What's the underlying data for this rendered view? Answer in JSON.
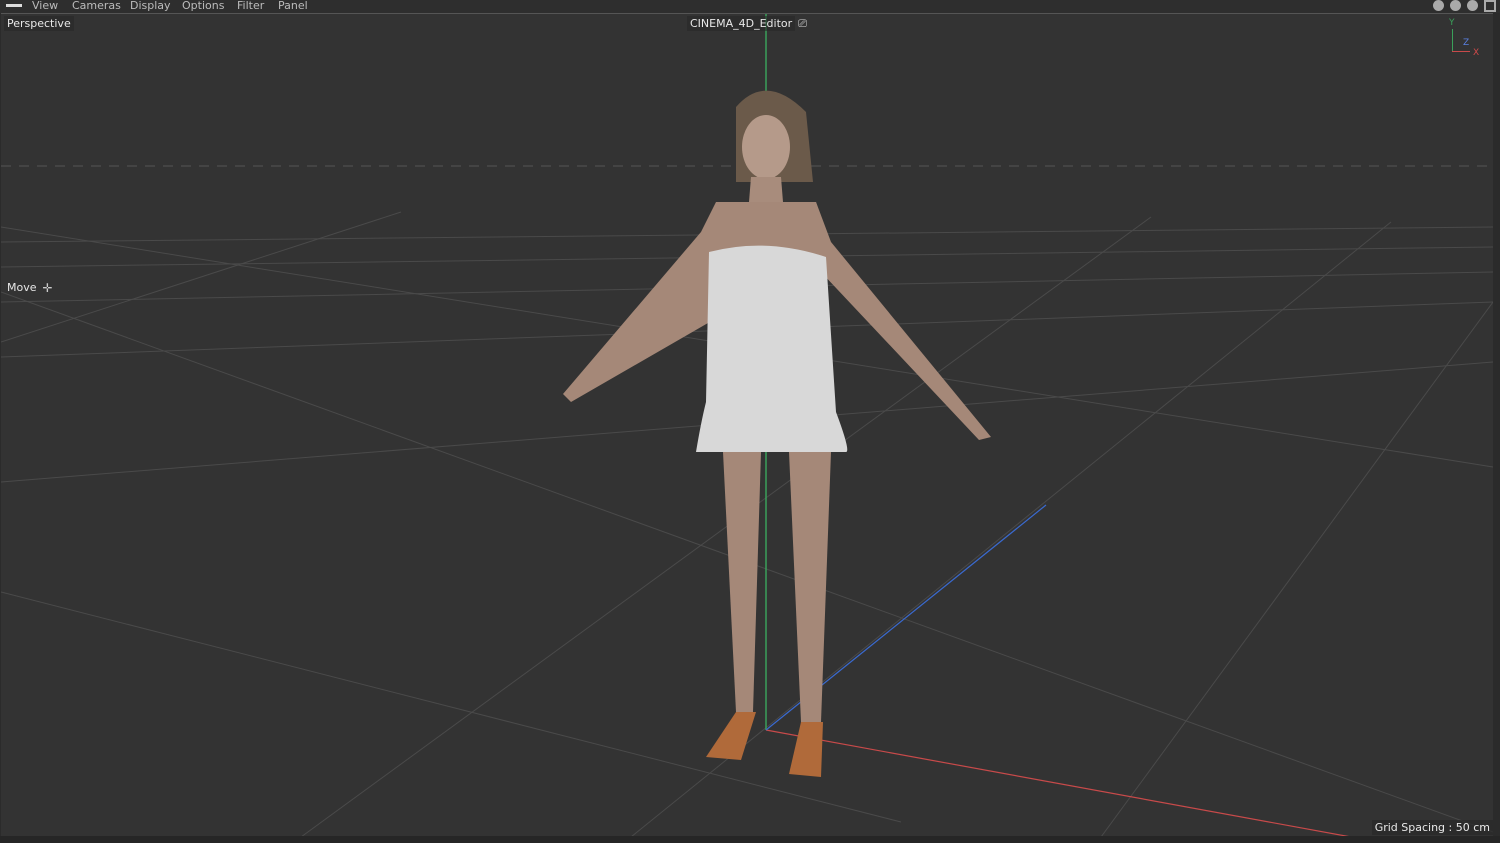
{
  "menu": {
    "items": [
      "View",
      "Cameras",
      "Display",
      "Options",
      "Filter",
      "Panel"
    ]
  },
  "viewport": {
    "camera_label": "Perspective",
    "camera_name": "CINEMA_4D_Editor",
    "tool_label": "Move",
    "grid_spacing": "Grid Spacing : 50 cm",
    "axis": {
      "y": "Y",
      "z": "Z",
      "x": "X"
    }
  },
  "colors": {
    "background": "#333333",
    "x_axis": "#c84a4a",
    "y_axis": "#3aa05a",
    "z_axis": "#3a6ad0"
  }
}
